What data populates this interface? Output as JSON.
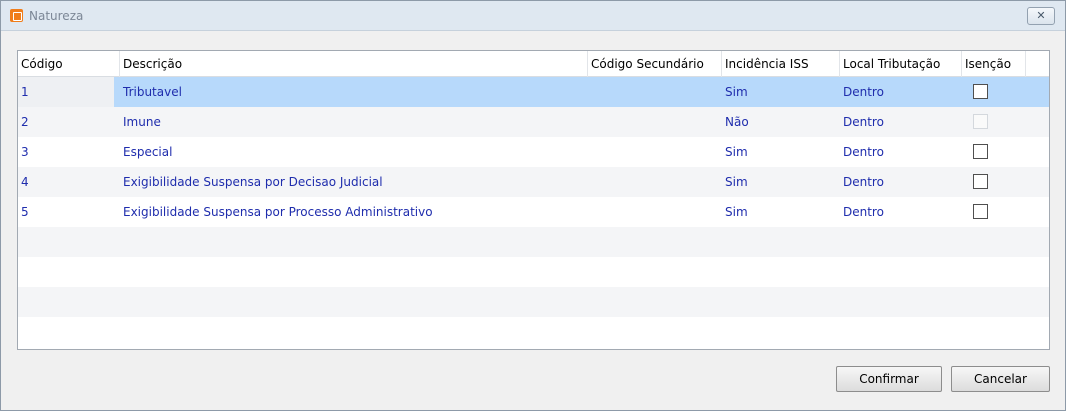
{
  "window": {
    "title": "Natureza",
    "close_glyph": "✕"
  },
  "columns": [
    "Código",
    "Descrição",
    "Código Secundário",
    "Incidência ISS",
    "Local Tributação",
    "Isenção"
  ],
  "rows": [
    {
      "codigo": "1",
      "descricao": "Tributavel",
      "codigo_secundario": "",
      "incidencia_iss": "Sim",
      "local_tributacao": "Dentro",
      "isencao_checked": false,
      "isencao_enabled": true
    },
    {
      "codigo": "2",
      "descricao": "Imune",
      "codigo_secundario": "",
      "incidencia_iss": "Não",
      "local_tributacao": "Dentro",
      "isencao_checked": false,
      "isencao_enabled": false
    },
    {
      "codigo": "3",
      "descricao": "Especial",
      "codigo_secundario": "",
      "incidencia_iss": "Sim",
      "local_tributacao": "Dentro",
      "isencao_checked": false,
      "isencao_enabled": true
    },
    {
      "codigo": "4",
      "descricao": "Exigibilidade Suspensa por Decisao Judicial",
      "codigo_secundario": "",
      "incidencia_iss": "Sim",
      "local_tributacao": "Dentro",
      "isencao_checked": false,
      "isencao_enabled": true
    },
    {
      "codigo": "5",
      "descricao": "Exigibilidade Suspensa por Processo Administrativo",
      "codigo_secundario": "",
      "incidencia_iss": "Sim",
      "local_tributacao": "Dentro",
      "isencao_checked": false,
      "isencao_enabled": true
    }
  ],
  "buttons": {
    "confirm_label": "Confirmar",
    "cancel_label": "Cancelar"
  },
  "colors": {
    "selected_row": "#b7d9fb",
    "data_text": "#1f2dad"
  }
}
